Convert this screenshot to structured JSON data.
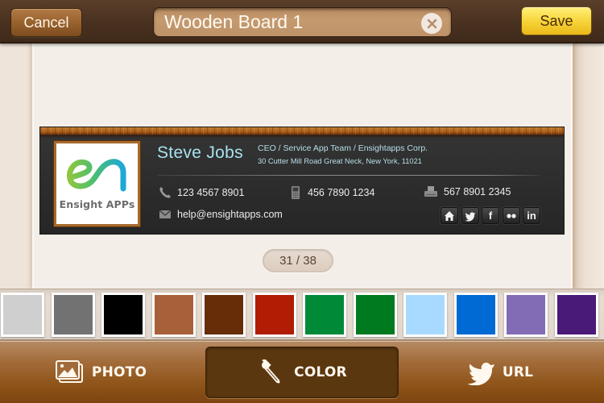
{
  "navbar": {
    "cancel_label": "Cancel",
    "save_label": "Save",
    "title_value": "Wooden Board 1",
    "clear_icon": "clear-circle-x-icon"
  },
  "card": {
    "logo_text": "Ensight APPs",
    "name": "Steve Jobs",
    "job_title": "CEO / Service App Team / Ensightapps Corp.",
    "address": "30 Cutter Mill Road Great Neck, New York, 11021",
    "phone": "123 4567 8901",
    "mobile": "456 7890 1234",
    "fax": "567 8901 2345",
    "email": "help@ensightapps.com",
    "name_color": "#a8e2f0",
    "socials": [
      {
        "name": "home",
        "icon": "home-icon"
      },
      {
        "name": "twitter",
        "icon": "twitter-icon"
      },
      {
        "name": "facebook",
        "icon": "facebook-icon",
        "glyph": "f"
      },
      {
        "name": "flickr",
        "icon": "flickr-icon"
      },
      {
        "name": "linkedin",
        "icon": "linkedin-icon",
        "glyph": "in"
      }
    ]
  },
  "pager": {
    "current": 31,
    "total": 38,
    "label": "31 / 38"
  },
  "swatches": [
    {
      "name": "light-gray",
      "color": "#cfcfcf"
    },
    {
      "name": "gray",
      "color": "#727272"
    },
    {
      "name": "black",
      "color": "#000000"
    },
    {
      "name": "sienna",
      "color": "#a8603a"
    },
    {
      "name": "brown",
      "color": "#662d08"
    },
    {
      "name": "red",
      "color": "#b01c04"
    },
    {
      "name": "green",
      "color": "#008a38"
    },
    {
      "name": "dark-green",
      "color": "#007a1e"
    },
    {
      "name": "light-blue",
      "color": "#a8daff"
    },
    {
      "name": "blue",
      "color": "#006ad4"
    },
    {
      "name": "lavender",
      "color": "#826cb6"
    },
    {
      "name": "purple",
      "color": "#4a1a78"
    }
  ],
  "toolbar": {
    "photo_label": "PHOTO",
    "color_label": "COLOR",
    "url_label": "URL",
    "selected": "COLOR"
  }
}
